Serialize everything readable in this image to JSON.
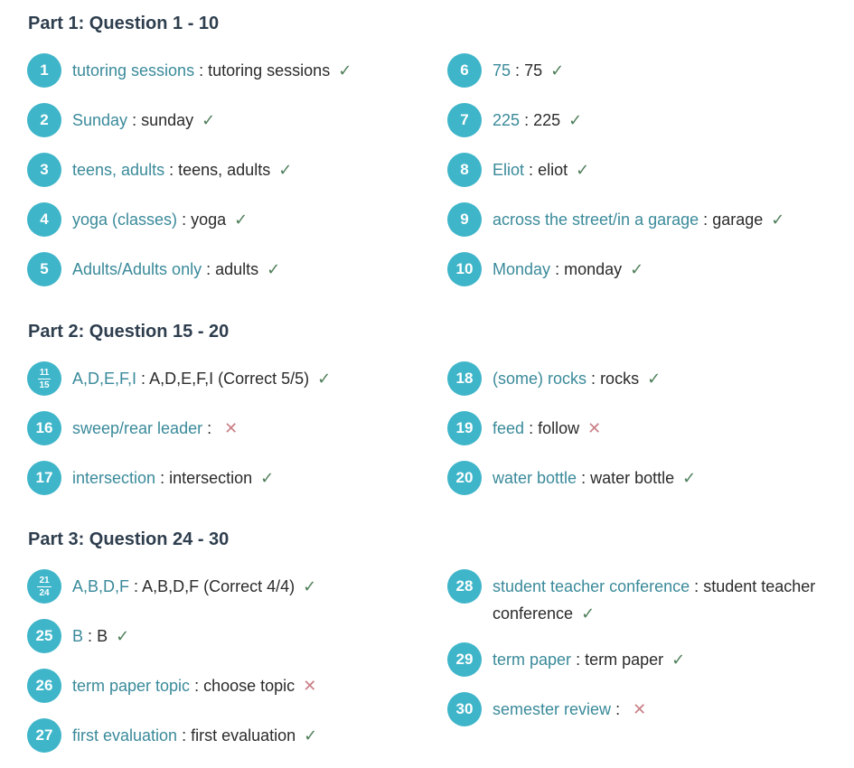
{
  "parts": [
    {
      "title": "Part 1: Question 1 - 10",
      "left": [
        {
          "num": "1",
          "key": "tutoring sessions",
          "answer": "tutoring sessions",
          "result": "correct"
        },
        {
          "num": "2",
          "key": "Sunday",
          "answer": "sunday",
          "result": "correct"
        },
        {
          "num": "3",
          "key": "teens, adults",
          "answer": "teens, adults",
          "result": "correct"
        },
        {
          "num": "4",
          "key": "yoga (classes)",
          "answer": "yoga",
          "result": "correct"
        },
        {
          "num": "5",
          "key": "Adults/Adults only",
          "answer": "adults",
          "result": "correct"
        }
      ],
      "right": [
        {
          "num": "6",
          "key": "75",
          "answer": "75",
          "result": "correct"
        },
        {
          "num": "7",
          "key": "225",
          "answer": "225",
          "result": "correct"
        },
        {
          "num": "8",
          "key": "Eliot",
          "answer": "eliot",
          "result": "correct"
        },
        {
          "num": "9",
          "key": "across the street/in a garage",
          "answer": "garage",
          "result": "correct"
        },
        {
          "num": "10",
          "key": "Monday",
          "answer": "monday",
          "result": "correct"
        }
      ]
    },
    {
      "title": "Part 2: Question 15 - 20",
      "left": [
        {
          "num_top": "11",
          "num_bottom": "15",
          "key": "A,D,E,F,I",
          "answer": "A,D,E,F,I (Correct 5/5)",
          "result": "correct"
        },
        {
          "num": "16",
          "key": "sweep/rear leader",
          "answer": "",
          "result": "wrong"
        },
        {
          "num": "17",
          "key": "intersection",
          "answer": "intersection",
          "result": "correct"
        }
      ],
      "right": [
        {
          "num": "18",
          "key": "(some) rocks",
          "answer": "rocks",
          "result": "correct"
        },
        {
          "num": "19",
          "key": "feed",
          "answer": "follow",
          "result": "wrong"
        },
        {
          "num": "20",
          "key": "water bottle",
          "answer": "water bottle",
          "result": "correct"
        }
      ]
    },
    {
      "title": "Part 3: Question 24 - 30",
      "left": [
        {
          "num_top": "21",
          "num_bottom": "24",
          "key": "A,B,D,F",
          "answer": "A,B,D,F (Correct 4/4)",
          "result": "correct"
        },
        {
          "num": "25",
          "key": "B",
          "answer": "B",
          "result": "correct"
        },
        {
          "num": "26",
          "key": "term paper topic",
          "answer": "choose topic",
          "result": "wrong"
        },
        {
          "num": "27",
          "key": "first evaluation",
          "answer": "first evaluation",
          "result": "correct"
        }
      ],
      "right": [
        {
          "num": "28",
          "key": "student teacher conference",
          "answer": "student teacher conference",
          "result": "correct"
        },
        {
          "num": "29",
          "key": "term paper",
          "answer": "term paper",
          "result": "correct"
        },
        {
          "num": "30",
          "key": "semester review",
          "answer": "",
          "result": "wrong"
        }
      ]
    }
  ],
  "separator": ":",
  "icons": {
    "correct": "check-icon",
    "wrong": "cross-icon"
  },
  "colors": {
    "badge": "#3fb5c9",
    "key_text": "#3a8a9a",
    "correct": "#4f7f5a",
    "wrong": "#c97f86",
    "heading": "#2e3e4e"
  }
}
